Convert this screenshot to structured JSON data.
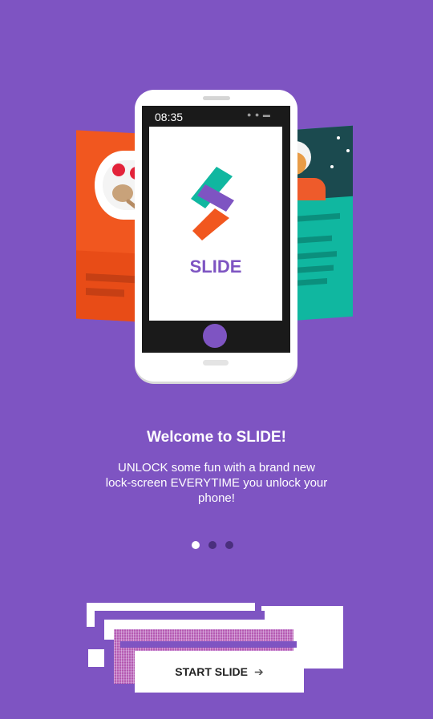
{
  "illustration": {
    "phone_time": "08:35",
    "logo_text": "SLIDE"
  },
  "onboarding": {
    "title": "Welcome to SLIDE!",
    "subtitle": "UNLOCK some fun with a brand new lock-screen EVERYTIME you unlock your phone!",
    "pager": {
      "total_pages": 3,
      "current_page": 1
    }
  },
  "cta": {
    "label": "START SLIDE",
    "icon": "arrow-right-icon"
  },
  "colors": {
    "background": "#7e54c2",
    "accent_orange": "#f1571f",
    "accent_teal": "#10b7a0",
    "dot_active": "#ffffff",
    "dot_inactive": "#4a2f7d"
  }
}
